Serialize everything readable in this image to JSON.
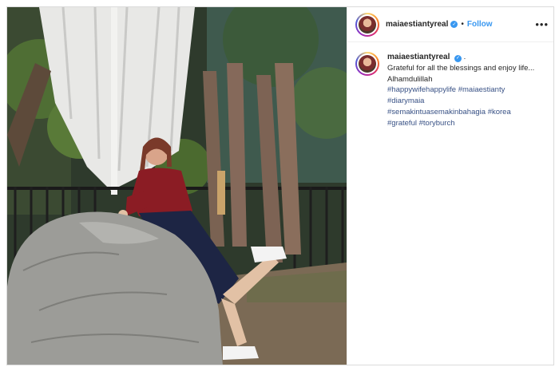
{
  "post": {
    "username": "maiaestiantyreal",
    "follow_label": "Follow",
    "separator": "•",
    "more_label": "•••",
    "verified_glyph": "✓",
    "caption_suffix": ".",
    "caption_text": "Grateful for all the blessings and enjoy life... Alhamdulillah",
    "hashtag_lines": [
      "#happywifehappylife #maiaestianty",
      "#diarymaia",
      "#semakintuasemakinbahagia #korea",
      "#grateful #toryburch"
    ]
  },
  "colors": {
    "link_blue": "#3897f0",
    "hashtag": "#385185",
    "text": "#262626"
  },
  "photo": {
    "description_icon": "photo-of-woman-leaning-on-rock"
  }
}
